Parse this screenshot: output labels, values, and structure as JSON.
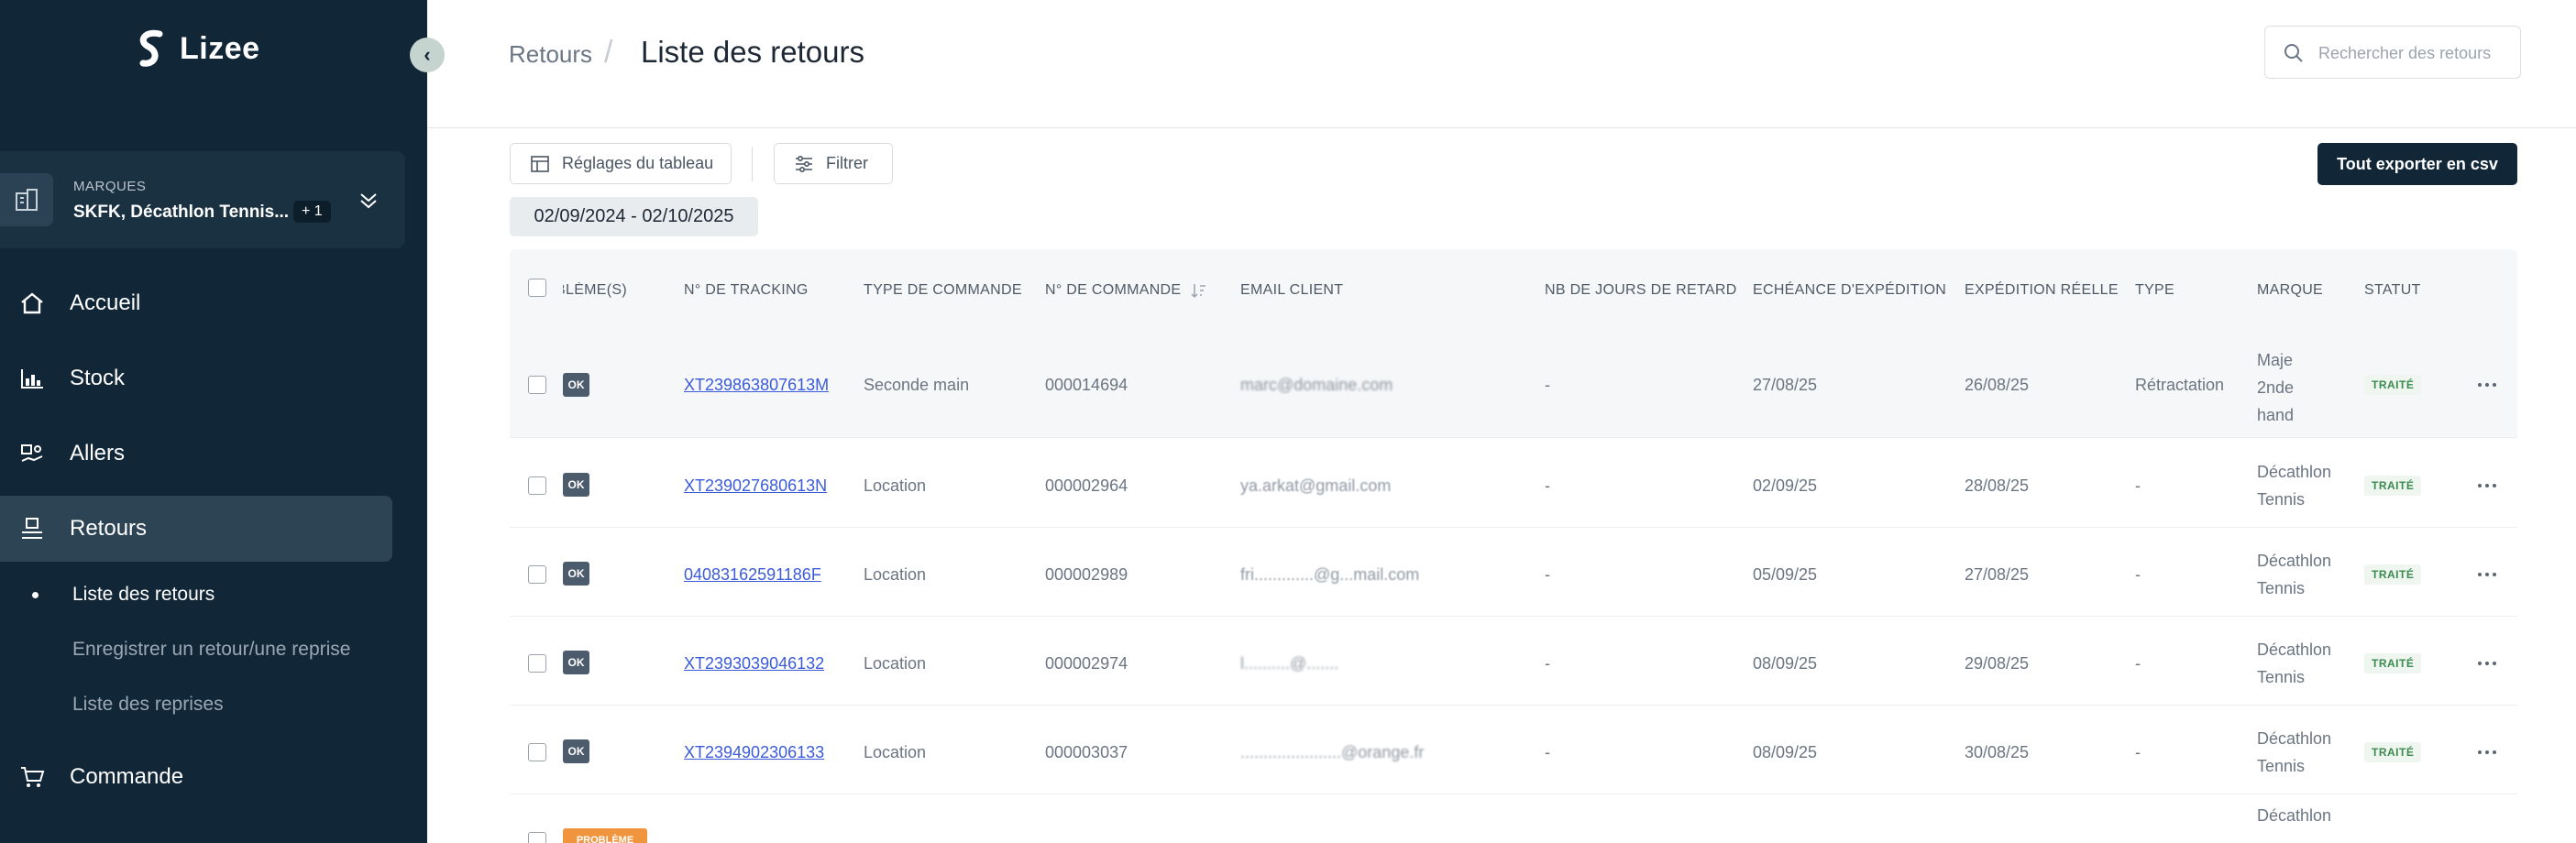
{
  "app": {
    "name": "Lizee"
  },
  "sidebar": {
    "brand_label": "MARQUES",
    "brand_value": "SKFK, Décathlon Tennis...",
    "brand_extra": "+ 1",
    "nav": [
      {
        "label": "Accueil",
        "icon": "home-icon"
      },
      {
        "label": "Stock",
        "icon": "stock-chart-icon"
      },
      {
        "label": "Allers",
        "icon": "delivery-icon"
      },
      {
        "label": "Retours",
        "icon": "returns-icon"
      },
      {
        "label": "Commande",
        "icon": "cart-icon"
      }
    ],
    "sub": [
      {
        "label": "Liste des retours"
      },
      {
        "label": "Enregistrer un retour/une reprise"
      },
      {
        "label": "Liste des reprises"
      }
    ]
  },
  "header": {
    "breadcrumb_parent": "Retours",
    "title": "Liste des retours",
    "search_placeholder": "Rechercher des retours"
  },
  "toolbar": {
    "settings_label": "Réglages du tableau",
    "filter_label": "Filtrer",
    "export_label": "Tout exporter en csv",
    "date_range": "02/09/2024 - 02/10/2025"
  },
  "table": {
    "columns": [
      "PROBLÈME(S)",
      "N° DE TRACKING",
      "TYPE DE COMMANDE",
      "N° DE COMMANDE",
      "EMAIL CLIENT",
      "NB DE JOURS DE RETARD",
      "ECHÉANCE D'EXPÉDITION",
      "EXPÉDITION RÉELLE",
      "TYPE",
      "MARQUE",
      "STATUT"
    ],
    "rows": [
      {
        "problem": "OK",
        "tracking": "XT239863807613M",
        "order_type": "Seconde main",
        "order_no": "000014694",
        "email": "marc@domaine.com",
        "delay": "-",
        "due": "27/08/25",
        "shipped": "26/08/25",
        "type": "Rétractation",
        "brand": [
          "Maje",
          "2nde",
          "hand"
        ],
        "status": "TRAITÉ"
      },
      {
        "problem": "OK",
        "tracking": "XT239027680613N",
        "order_type": "Location",
        "order_no": "000002964",
        "email": "ya.arkat@gmail.com",
        "delay": "-",
        "due": "02/09/25",
        "shipped": "28/08/25",
        "type": "-",
        "brand": [
          "Décathlon",
          "Tennis"
        ],
        "status": "TRAITÉ"
      },
      {
        "problem": "OK",
        "tracking": "04083162591186F",
        "order_type": "Location",
        "order_no": "000002989",
        "email": "fri.............@g...mail.com",
        "delay": "-",
        "due": "05/09/25",
        "shipped": "27/08/25",
        "type": "-",
        "brand": [
          "Décathlon",
          "Tennis"
        ],
        "status": "TRAITÉ"
      },
      {
        "problem": "OK",
        "tracking": "XT2393039046132",
        "order_type": "Location",
        "order_no": "000002974",
        "email": "l..........@.......",
        "delay": "-",
        "due": "08/09/25",
        "shipped": "29/08/25",
        "type": "-",
        "brand": [
          "Décathlon",
          "Tennis"
        ],
        "status": "TRAITÉ"
      },
      {
        "problem": "OK",
        "tracking": "XT2394902306133",
        "order_type": "Location",
        "order_no": "000003037",
        "email": "......................@orange.fr",
        "delay": "-",
        "due": "08/09/25",
        "shipped": "30/08/25",
        "type": "-",
        "brand": [
          "Décathlon",
          "Tennis"
        ],
        "status": "TRAITÉ"
      }
    ],
    "partial_row": {
      "problem": "PROBLÈME",
      "brand": "Décathlon"
    }
  },
  "colors": {
    "sidebar_bg": "#112637",
    "accent_link": "#3b5bd9",
    "status_green": "#3c8a4f",
    "warning": "#f0953e"
  }
}
